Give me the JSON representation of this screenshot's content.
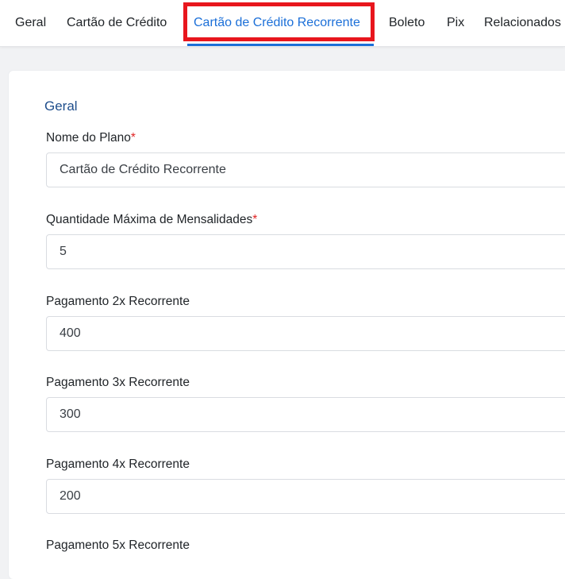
{
  "tabs": [
    {
      "label": "Geral"
    },
    {
      "label": "Cartão de Crédito"
    },
    {
      "label": "Cartão de Crédito Recorrente",
      "active": true
    },
    {
      "label": "Boleto"
    },
    {
      "label": "Pix"
    },
    {
      "label": "Relacionados"
    }
  ],
  "section": {
    "title": "Geral"
  },
  "fields": [
    {
      "label": "Nome do Plano",
      "required": "*",
      "value": "Cartão de Crédito Recorrente"
    },
    {
      "label": "Quantidade Máxima de Mensalidades",
      "required": "*",
      "value": "5"
    },
    {
      "label": "Pagamento 2x Recorrente",
      "value": "400"
    },
    {
      "label": "Pagamento 3x Recorrente",
      "value": "300"
    },
    {
      "label": "Pagamento 4x Recorrente",
      "value": "200"
    },
    {
      "label": "Pagamento 5x Recorrente"
    }
  ],
  "colors": {
    "accent": "#1b6fd8",
    "highlight": "#e8161d",
    "required": "#e02424",
    "section_title": "#1f4e8c"
  }
}
